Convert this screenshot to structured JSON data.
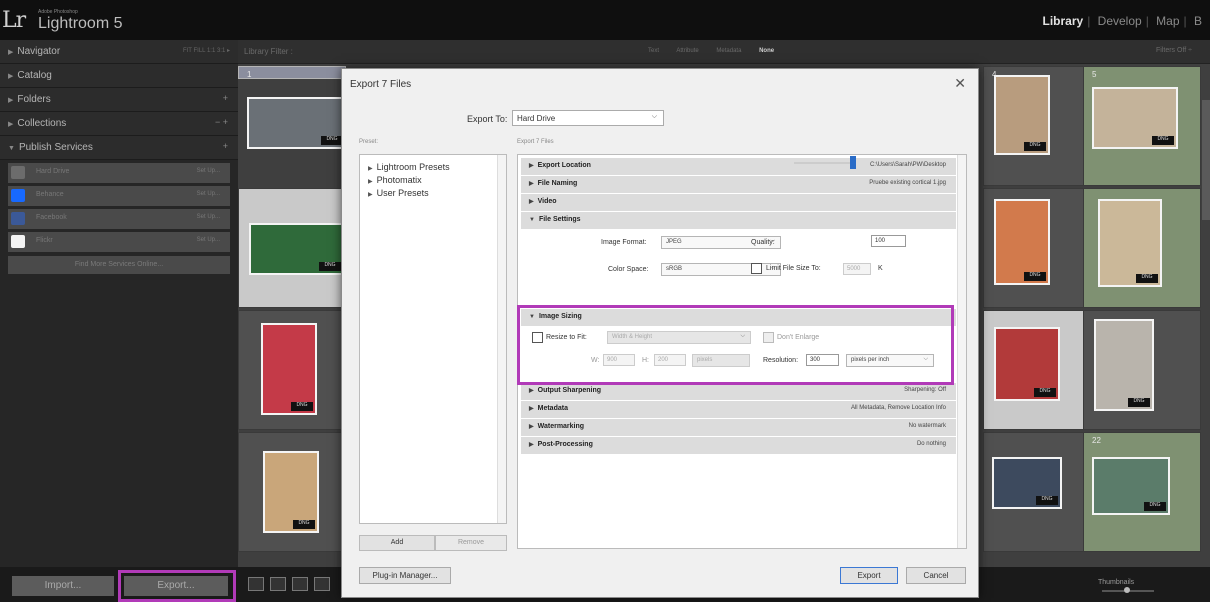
{
  "app": {
    "subtitle": "Adobe Photoshop",
    "name": "Lightroom 5",
    "logo": "Lr"
  },
  "modules": [
    {
      "label": "Library",
      "active": true
    },
    {
      "label": "Develop",
      "active": false
    },
    {
      "label": "Map",
      "active": false
    },
    {
      "label": "B",
      "active": false
    }
  ],
  "left_panel": {
    "navigator": {
      "label": "Navigator",
      "zoom_options": "FIT  FILL  1:1  3:1 ▸"
    },
    "catalog": "Catalog",
    "folders": "Folders",
    "collections": "Collections",
    "publish_services": "Publish Services",
    "services": [
      {
        "name": "Hard Drive",
        "setup": "Set Up...",
        "icon_color": "#6c6c6c",
        "icon": "hard-drive-icon"
      },
      {
        "name": "Behance",
        "setup": "Set Up...",
        "icon_color": "#1769ff",
        "icon": "behance-icon"
      },
      {
        "name": "Facebook",
        "setup": "Set Up...",
        "icon_color": "#3b5998",
        "icon": "facebook-icon"
      },
      {
        "name": "Flickr",
        "setup": "Set Up...",
        "icon_color": "#f4f4f4",
        "icon": "flickr-icon"
      }
    ],
    "find_more": "Find More Services Online..."
  },
  "filter_bar": {
    "label": "Library Filter :",
    "options": [
      {
        "label": "Text",
        "on": false
      },
      {
        "label": "Attribute",
        "on": false
      },
      {
        "label": "Metadata",
        "on": false
      },
      {
        "label": "None",
        "on": true
      }
    ],
    "filters_off": "Filters Off ÷"
  },
  "grid": {
    "info_badge": "DNG",
    "cells": [
      {
        "number": "1",
        "style": "sel",
        "thumb_color": "#6a7076"
      },
      {
        "number": "4",
        "style": "",
        "thumb_color": "#b89c7e"
      },
      {
        "number": "5",
        "style": "gr",
        "thumb_color": "#c4b39a"
      },
      {
        "number": "",
        "style": "lt",
        "thumb_color": "#2f6a3a"
      },
      {
        "number": "",
        "style": "",
        "thumb_color": "#d27a4c"
      },
      {
        "number": "",
        "style": "gr",
        "thumb_color": "#cbb899"
      },
      {
        "number": "",
        "style": "",
        "thumb_color": "#c43a48"
      },
      {
        "number": "",
        "style": "lt",
        "thumb_color": "#b23a3a"
      },
      {
        "number": "",
        "style": "",
        "thumb_color": "#b9b4ac"
      },
      {
        "number": "",
        "style": "",
        "thumb_color": "#c9a67a"
      },
      {
        "number": "",
        "style": "",
        "thumb_color": "#3d4a5e"
      },
      {
        "number": "22",
        "style": "gr",
        "thumb_color": "#5b7c6a"
      }
    ]
  },
  "bottom": {
    "import": "Import...",
    "export": "Export...",
    "sort_label": "Thumbnails"
  },
  "dialog": {
    "title": "Export 7 Files",
    "export_to_label": "Export To:",
    "export_to_value": "Hard Drive",
    "presets_label": "Preset:",
    "files_label": "Export 7 Files",
    "presets": [
      "Lightroom Presets",
      "Photomatix",
      "User Presets"
    ],
    "add": "Add",
    "remove": "Remove",
    "sections": {
      "export_location": {
        "title": "Export Location",
        "summary": "C:\\Users\\Sarah\\PW\\Desktop"
      },
      "file_naming": {
        "title": "File Naming",
        "summary": "Pruebe existing cortical 1.jpg"
      },
      "video": {
        "title": "Video"
      },
      "file_settings": {
        "title": "File Settings"
      },
      "image_sizing": {
        "title": "Image Sizing"
      },
      "output_sharpening": {
        "title": "Output Sharpening",
        "summary": "Sharpening: Off"
      },
      "metadata": {
        "title": "Metadata",
        "summary": "All Metadata, Remove Location Info"
      },
      "watermarking": {
        "title": "Watermarking",
        "summary": "No watermark"
      },
      "post_processing": {
        "title": "Post-Processing",
        "summary": "Do nothing"
      }
    },
    "file_settings": {
      "format_label": "Image Format:",
      "format_value": "JPEG",
      "quality_label": "Quality:",
      "quality_value": "100",
      "quality_level": 0.95,
      "colorspace_label": "Color Space:",
      "colorspace_value": "sRGB",
      "limit_label": "Limit File Size To:",
      "limit_value": "5000",
      "limit_unit": "K"
    },
    "image_sizing": {
      "resize_label": "Resize to Fit:",
      "resize_value": "Width & Height",
      "dont_enlarge": "Don't Enlarge",
      "w_label": "W:",
      "w_value": "900",
      "h_label": "H:",
      "h_value": "200",
      "unit_value": "pixels",
      "resolution_label": "Resolution:",
      "resolution_value": "300",
      "resolution_unit": "pixels per inch"
    },
    "plugin_manager": "Plug-in Manager...",
    "export_button": "Export",
    "cancel_button": "Cancel"
  },
  "colors": {
    "highlight": "#b13ab8",
    "dialog_bg": "#f0f0f0",
    "panel_bg": "#262626"
  }
}
